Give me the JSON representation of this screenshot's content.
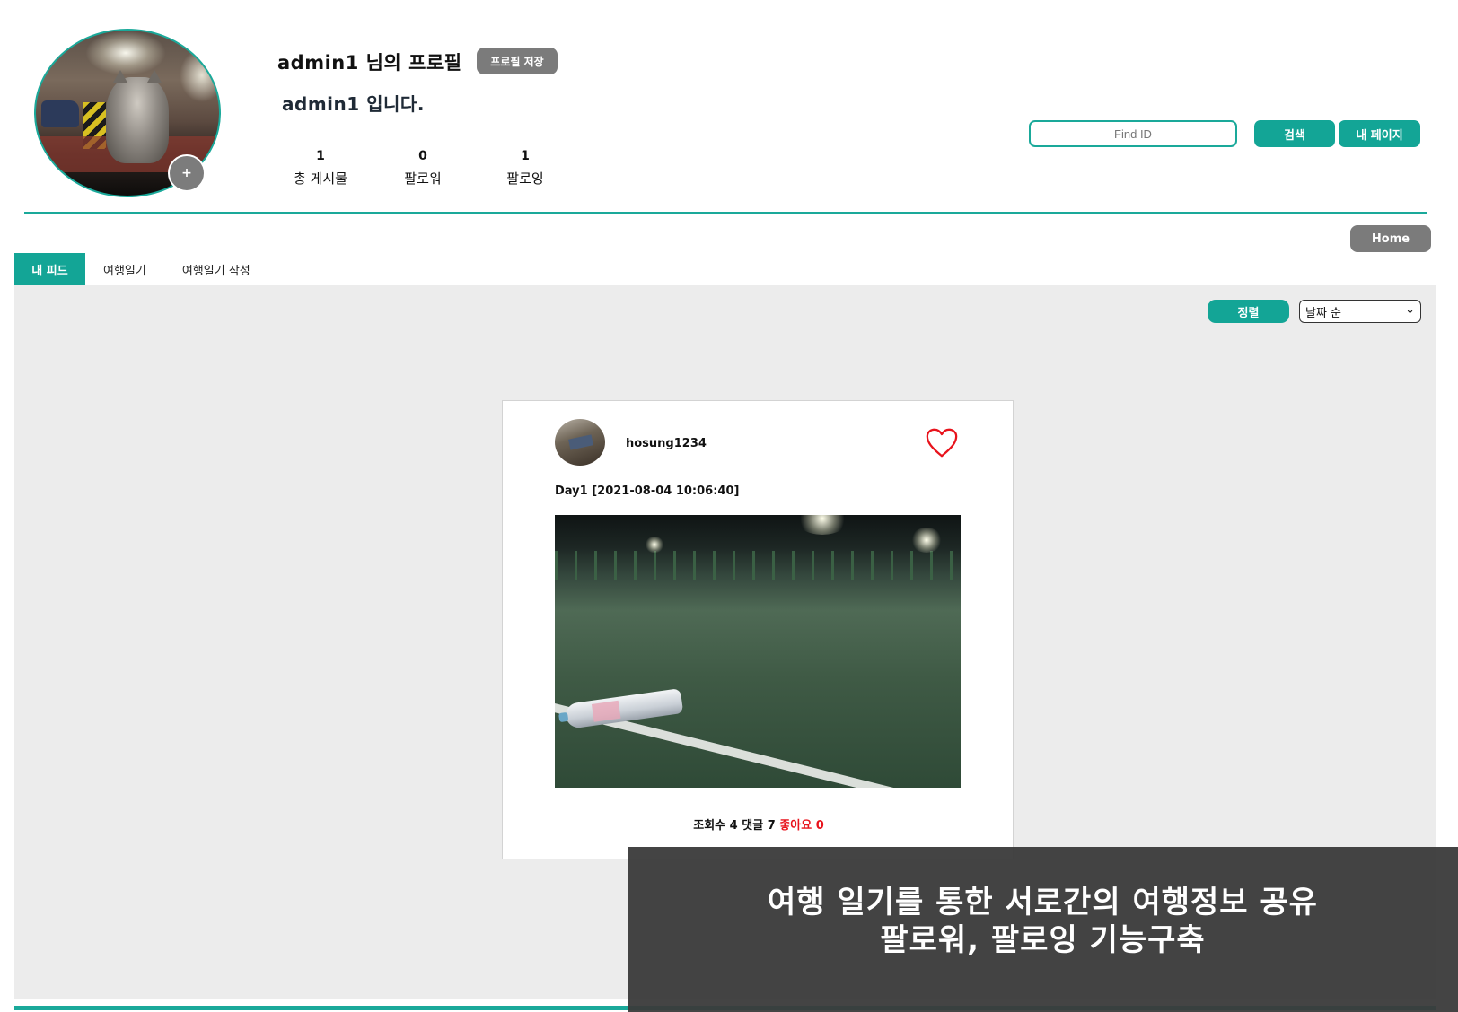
{
  "profile": {
    "username": "admin1",
    "title_suffix": "님의 프로필",
    "save_label": "프로필 저장",
    "intro": "admin1 입니다.",
    "add_label": "+",
    "stats": [
      {
        "value": "1",
        "label": "총 게시물"
      },
      {
        "value": "0",
        "label": "팔로워"
      },
      {
        "value": "1",
        "label": "팔로잉"
      }
    ]
  },
  "search": {
    "placeholder": "Find ID",
    "button_label": "검색",
    "mypage_label": "내 페이지"
  },
  "home_label": "Home",
  "tabs": [
    {
      "label": "내 피드",
      "active": true
    },
    {
      "label": "여행일기",
      "active": false
    },
    {
      "label": "여행일기 작성",
      "active": false
    }
  ],
  "sort": {
    "button_label": "정렬",
    "selected": "날짜 순"
  },
  "post": {
    "author": "hosung1234",
    "title": "Day1 [2021-08-04 10:06:40]",
    "views_label": "조회수",
    "views": "4",
    "comments_label": "댓글",
    "comments": "7",
    "likes_label": "좋아요",
    "likes": "0"
  },
  "banner": {
    "line1": "여행 일기를 통한 서로간의 여행정보 공유",
    "line2": "팔로워, 팔로잉 기능구축"
  },
  "colors": {
    "accent": "#13a596",
    "gray_button": "#7b7b7b",
    "feed_bg": "#ececec",
    "like_red": "#e8131c"
  }
}
